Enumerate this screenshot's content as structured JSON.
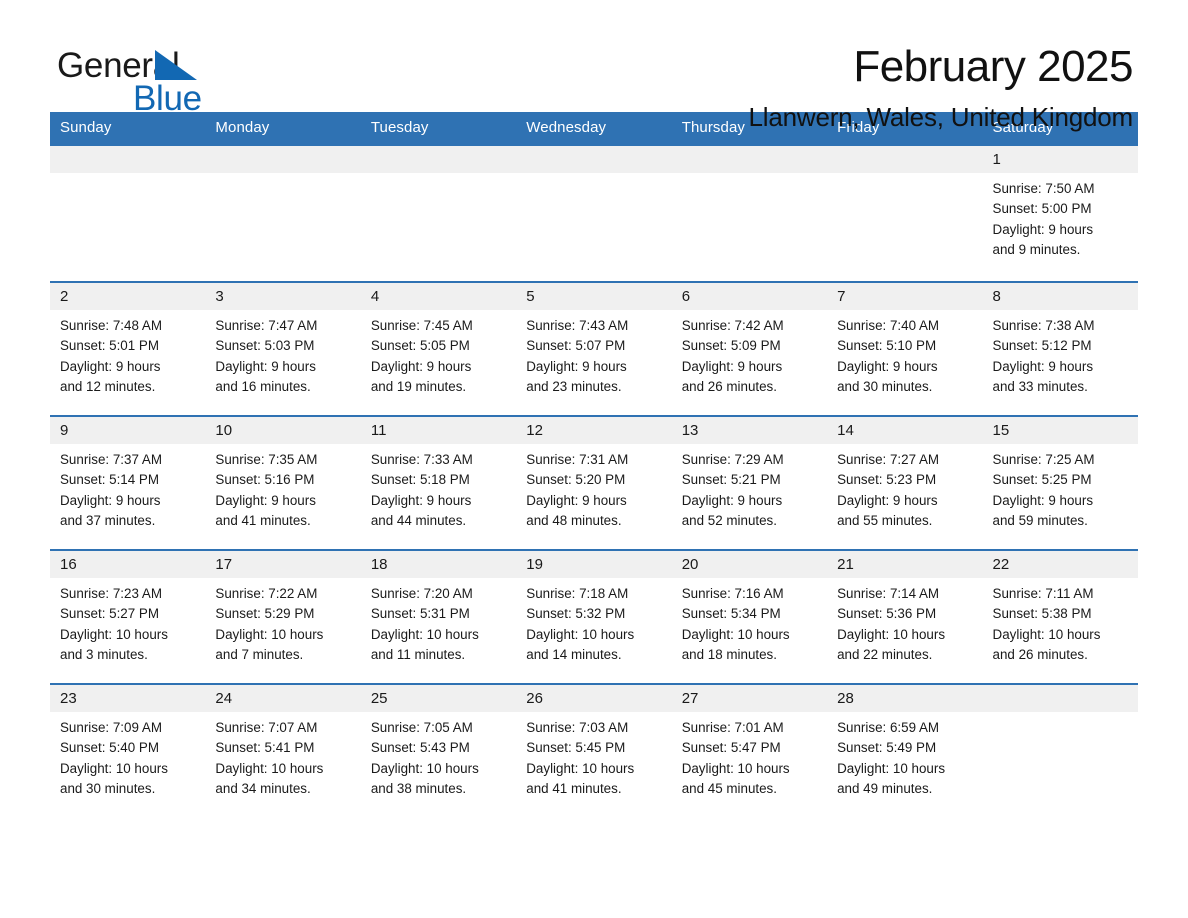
{
  "brand": {
    "logo_line1": "General",
    "logo_line2": "Blue",
    "logo_triangle_icon": "triangle-icon",
    "black": "#1a1a1a",
    "blue": "#1268b3"
  },
  "header": {
    "month_title": "February 2025",
    "location": "Llanwern, Wales, United Kingdom"
  },
  "theme": {
    "header_blue": "#2f72b3",
    "row_divider_blue": "#2f72b3",
    "daynum_band": "#f0f0f0",
    "text": "#1a1a1a",
    "page_background": "#ffffff"
  },
  "weekdays": [
    "Sunday",
    "Monday",
    "Tuesday",
    "Wednesday",
    "Thursday",
    "Friday",
    "Saturday"
  ],
  "weeks": [
    [
      {
        "day": "",
        "blank": true
      },
      {
        "day": "",
        "blank": true
      },
      {
        "day": "",
        "blank": true
      },
      {
        "day": "",
        "blank": true
      },
      {
        "day": "",
        "blank": true
      },
      {
        "day": "",
        "blank": true
      },
      {
        "day": "1",
        "sunrise": "Sunrise: 7:50 AM",
        "sunset": "Sunset: 5:00 PM",
        "daylight_line1": "Daylight: 9 hours",
        "daylight_line2": "and 9 minutes."
      }
    ],
    [
      {
        "day": "2",
        "sunrise": "Sunrise: 7:48 AM",
        "sunset": "Sunset: 5:01 PM",
        "daylight_line1": "Daylight: 9 hours",
        "daylight_line2": "and 12 minutes."
      },
      {
        "day": "3",
        "sunrise": "Sunrise: 7:47 AM",
        "sunset": "Sunset: 5:03 PM",
        "daylight_line1": "Daylight: 9 hours",
        "daylight_line2": "and 16 minutes."
      },
      {
        "day": "4",
        "sunrise": "Sunrise: 7:45 AM",
        "sunset": "Sunset: 5:05 PM",
        "daylight_line1": "Daylight: 9 hours",
        "daylight_line2": "and 19 minutes."
      },
      {
        "day": "5",
        "sunrise": "Sunrise: 7:43 AM",
        "sunset": "Sunset: 5:07 PM",
        "daylight_line1": "Daylight: 9 hours",
        "daylight_line2": "and 23 minutes."
      },
      {
        "day": "6",
        "sunrise": "Sunrise: 7:42 AM",
        "sunset": "Sunset: 5:09 PM",
        "daylight_line1": "Daylight: 9 hours",
        "daylight_line2": "and 26 minutes."
      },
      {
        "day": "7",
        "sunrise": "Sunrise: 7:40 AM",
        "sunset": "Sunset: 5:10 PM",
        "daylight_line1": "Daylight: 9 hours",
        "daylight_line2": "and 30 minutes."
      },
      {
        "day": "8",
        "sunrise": "Sunrise: 7:38 AM",
        "sunset": "Sunset: 5:12 PM",
        "daylight_line1": "Daylight: 9 hours",
        "daylight_line2": "and 33 minutes."
      }
    ],
    [
      {
        "day": "9",
        "sunrise": "Sunrise: 7:37 AM",
        "sunset": "Sunset: 5:14 PM",
        "daylight_line1": "Daylight: 9 hours",
        "daylight_line2": "and 37 minutes."
      },
      {
        "day": "10",
        "sunrise": "Sunrise: 7:35 AM",
        "sunset": "Sunset: 5:16 PM",
        "daylight_line1": "Daylight: 9 hours",
        "daylight_line2": "and 41 minutes."
      },
      {
        "day": "11",
        "sunrise": "Sunrise: 7:33 AM",
        "sunset": "Sunset: 5:18 PM",
        "daylight_line1": "Daylight: 9 hours",
        "daylight_line2": "and 44 minutes."
      },
      {
        "day": "12",
        "sunrise": "Sunrise: 7:31 AM",
        "sunset": "Sunset: 5:20 PM",
        "daylight_line1": "Daylight: 9 hours",
        "daylight_line2": "and 48 minutes."
      },
      {
        "day": "13",
        "sunrise": "Sunrise: 7:29 AM",
        "sunset": "Sunset: 5:21 PM",
        "daylight_line1": "Daylight: 9 hours",
        "daylight_line2": "and 52 minutes."
      },
      {
        "day": "14",
        "sunrise": "Sunrise: 7:27 AM",
        "sunset": "Sunset: 5:23 PM",
        "daylight_line1": "Daylight: 9 hours",
        "daylight_line2": "and 55 minutes."
      },
      {
        "day": "15",
        "sunrise": "Sunrise: 7:25 AM",
        "sunset": "Sunset: 5:25 PM",
        "daylight_line1": "Daylight: 9 hours",
        "daylight_line2": "and 59 minutes."
      }
    ],
    [
      {
        "day": "16",
        "sunrise": "Sunrise: 7:23 AM",
        "sunset": "Sunset: 5:27 PM",
        "daylight_line1": "Daylight: 10 hours",
        "daylight_line2": "and 3 minutes."
      },
      {
        "day": "17",
        "sunrise": "Sunrise: 7:22 AM",
        "sunset": "Sunset: 5:29 PM",
        "daylight_line1": "Daylight: 10 hours",
        "daylight_line2": "and 7 minutes."
      },
      {
        "day": "18",
        "sunrise": "Sunrise: 7:20 AM",
        "sunset": "Sunset: 5:31 PM",
        "daylight_line1": "Daylight: 10 hours",
        "daylight_line2": "and 11 minutes."
      },
      {
        "day": "19",
        "sunrise": "Sunrise: 7:18 AM",
        "sunset": "Sunset: 5:32 PM",
        "daylight_line1": "Daylight: 10 hours",
        "daylight_line2": "and 14 minutes."
      },
      {
        "day": "20",
        "sunrise": "Sunrise: 7:16 AM",
        "sunset": "Sunset: 5:34 PM",
        "daylight_line1": "Daylight: 10 hours",
        "daylight_line2": "and 18 minutes."
      },
      {
        "day": "21",
        "sunrise": "Sunrise: 7:14 AM",
        "sunset": "Sunset: 5:36 PM",
        "daylight_line1": "Daylight: 10 hours",
        "daylight_line2": "and 22 minutes."
      },
      {
        "day": "22",
        "sunrise": "Sunrise: 7:11 AM",
        "sunset": "Sunset: 5:38 PM",
        "daylight_line1": "Daylight: 10 hours",
        "daylight_line2": "and 26 minutes."
      }
    ],
    [
      {
        "day": "23",
        "sunrise": "Sunrise: 7:09 AM",
        "sunset": "Sunset: 5:40 PM",
        "daylight_line1": "Daylight: 10 hours",
        "daylight_line2": "and 30 minutes."
      },
      {
        "day": "24",
        "sunrise": "Sunrise: 7:07 AM",
        "sunset": "Sunset: 5:41 PM",
        "daylight_line1": "Daylight: 10 hours",
        "daylight_line2": "and 34 minutes."
      },
      {
        "day": "25",
        "sunrise": "Sunrise: 7:05 AM",
        "sunset": "Sunset: 5:43 PM",
        "daylight_line1": "Daylight: 10 hours",
        "daylight_line2": "and 38 minutes."
      },
      {
        "day": "26",
        "sunrise": "Sunrise: 7:03 AM",
        "sunset": "Sunset: 5:45 PM",
        "daylight_line1": "Daylight: 10 hours",
        "daylight_line2": "and 41 minutes."
      },
      {
        "day": "27",
        "sunrise": "Sunrise: 7:01 AM",
        "sunset": "Sunset: 5:47 PM",
        "daylight_line1": "Daylight: 10 hours",
        "daylight_line2": "and 45 minutes."
      },
      {
        "day": "28",
        "sunrise": "Sunrise: 6:59 AM",
        "sunset": "Sunset: 5:49 PM",
        "daylight_line1": "Daylight: 10 hours",
        "daylight_line2": "and 49 minutes."
      },
      {
        "day": "",
        "blank": true
      }
    ]
  ]
}
